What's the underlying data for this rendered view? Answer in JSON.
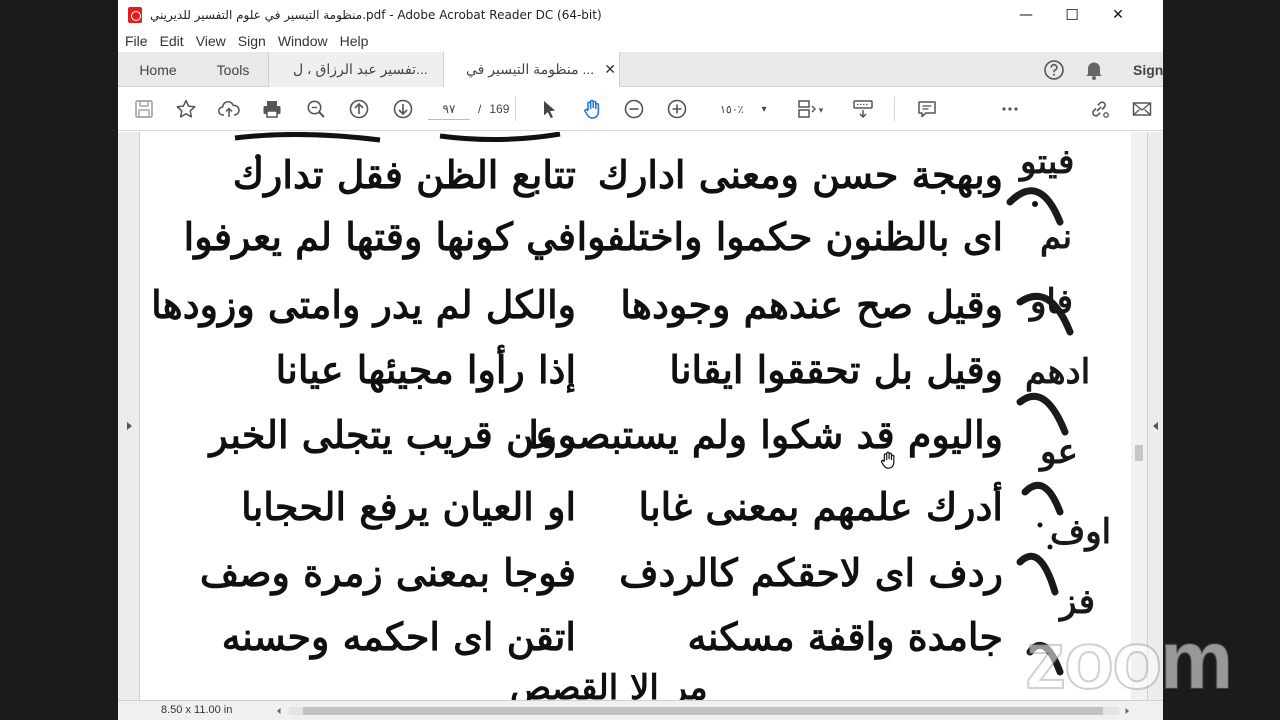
{
  "window": {
    "title": "منظومة التيسير في علوم التفسير للديريني.pdf - Adobe Acrobat Reader DC (64-bit)",
    "minimize_glyph": "—",
    "maximize_glyph": "☐",
    "close_glyph": "✕"
  },
  "menu": [
    "File",
    "Edit",
    "View",
    "Sign",
    "Window",
    "Help"
  ],
  "tabs": {
    "home": "Home",
    "tools": "Tools",
    "doc1": "تفسير عبد الرزاق ، ل...",
    "doc2": "منظومة التيسير في ...",
    "close_glyph": "✕",
    "sign": "Sign"
  },
  "toolbar": {
    "current_page": "٩٧",
    "page_separator": "/",
    "total_pages": "169",
    "zoom": "١٥٠٪",
    "zoom_caret": "▾"
  },
  "status": {
    "page_size": "8.50 x 11.00 in"
  },
  "document": {
    "left_column": [
      "تتابع الظن فقل تدارك",
      "في كونها وقتها لم يعرفوا",
      "والكل لم يدر وامتى وزودها",
      "إذا رأوا مجيئها عيانا",
      "وعن قريب يتجلى الخبر",
      "او العيان يرفع الحجابا",
      "فوجا بمعنى زمرة وصف",
      "اتقن اى احكمه وحسنه"
    ],
    "right_column": [
      "وبهجة حسن ومعنى ادارك",
      "اى بالظنون حكموا واختلفوا",
      "وقيل صح عندهم وجودها",
      "وقيل بل تحققوا ايقانا",
      "واليوم قد شكوا ولم يستبصروا",
      "أدرك علمهم بمعنى غابا",
      "ردف اى لاحقكم كالردف",
      "جامدة واقفة مسكنه"
    ],
    "side_fragments": [
      "فيتو",
      "نم",
      "فاو",
      "ادهم",
      "عو",
      "اوف",
      "فز"
    ],
    "bottom_fragment": "مر الا القصص"
  },
  "watermark": "zoom",
  "colors": {
    "accent": "#e02020",
    "hand_tool": "#1473e6",
    "canvas": "#8c8c8c"
  }
}
